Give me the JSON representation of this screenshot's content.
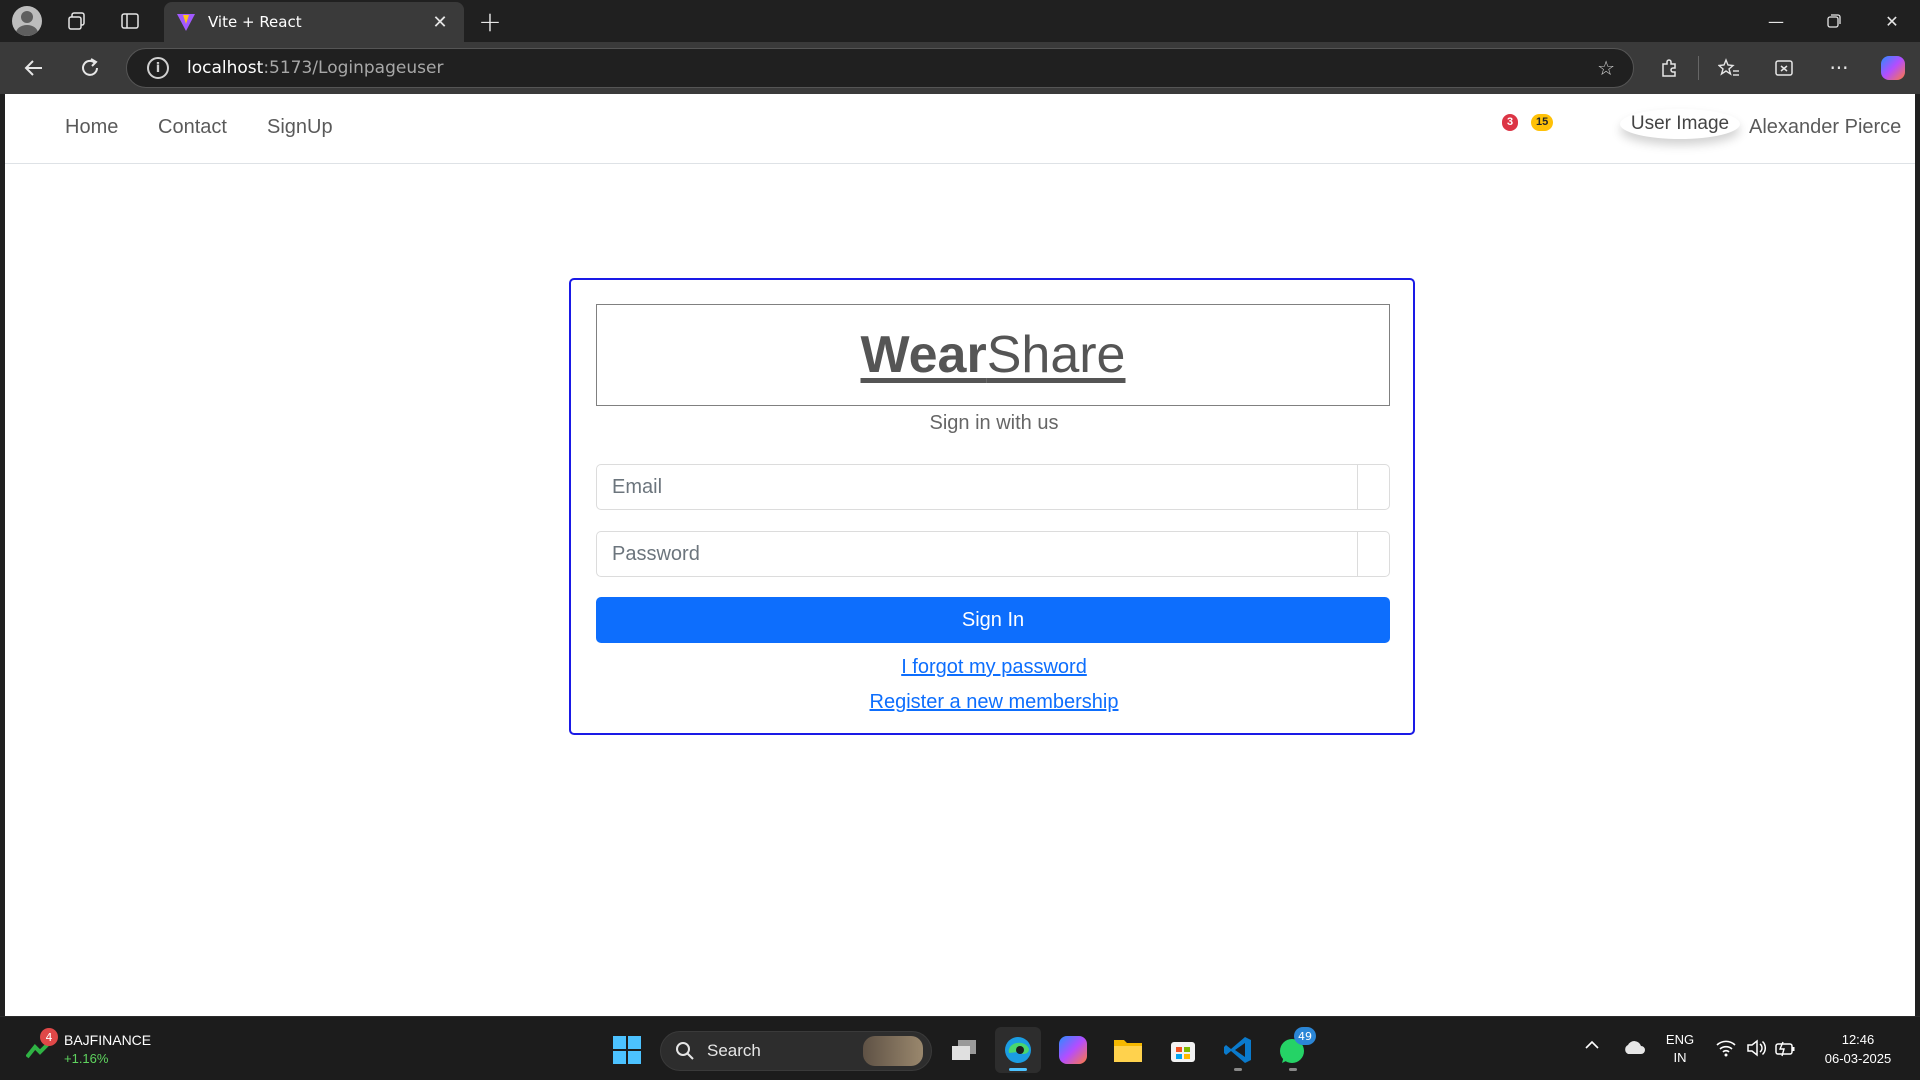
{
  "browser": {
    "tab_title": "Vite + React",
    "url_host": "localhost",
    "url_path": ":5173/Loginpageuser"
  },
  "nav": {
    "links": [
      "Home",
      "Contact",
      "SignUp"
    ],
    "badge_messages": "3",
    "badge_notifications": "15",
    "user_image_alt": "User Image",
    "user_name": "Alexander Pierce"
  },
  "login": {
    "brand_bold": "Wear",
    "brand_light": "Share",
    "subtitle": "Sign in with us",
    "email_placeholder": "Email",
    "password_placeholder": "Password",
    "signin_label": "Sign In",
    "forgot_label": "I forgot my password",
    "register_label": "Register a new membership"
  },
  "taskbar": {
    "stock_badge": "4",
    "stock_name": "BAJFINANCE",
    "stock_change": "+1.16%",
    "search_label": "Search",
    "whatsapp_badge": "49",
    "lang_line1": "ENG",
    "lang_line2": "IN",
    "time": "12:46",
    "date": "06-03-2025"
  },
  "colors": {
    "primary": "#0d6efd",
    "card_border": "#1a1ae6",
    "badge_red": "#dc3545",
    "badge_yellow": "#ffc107"
  }
}
